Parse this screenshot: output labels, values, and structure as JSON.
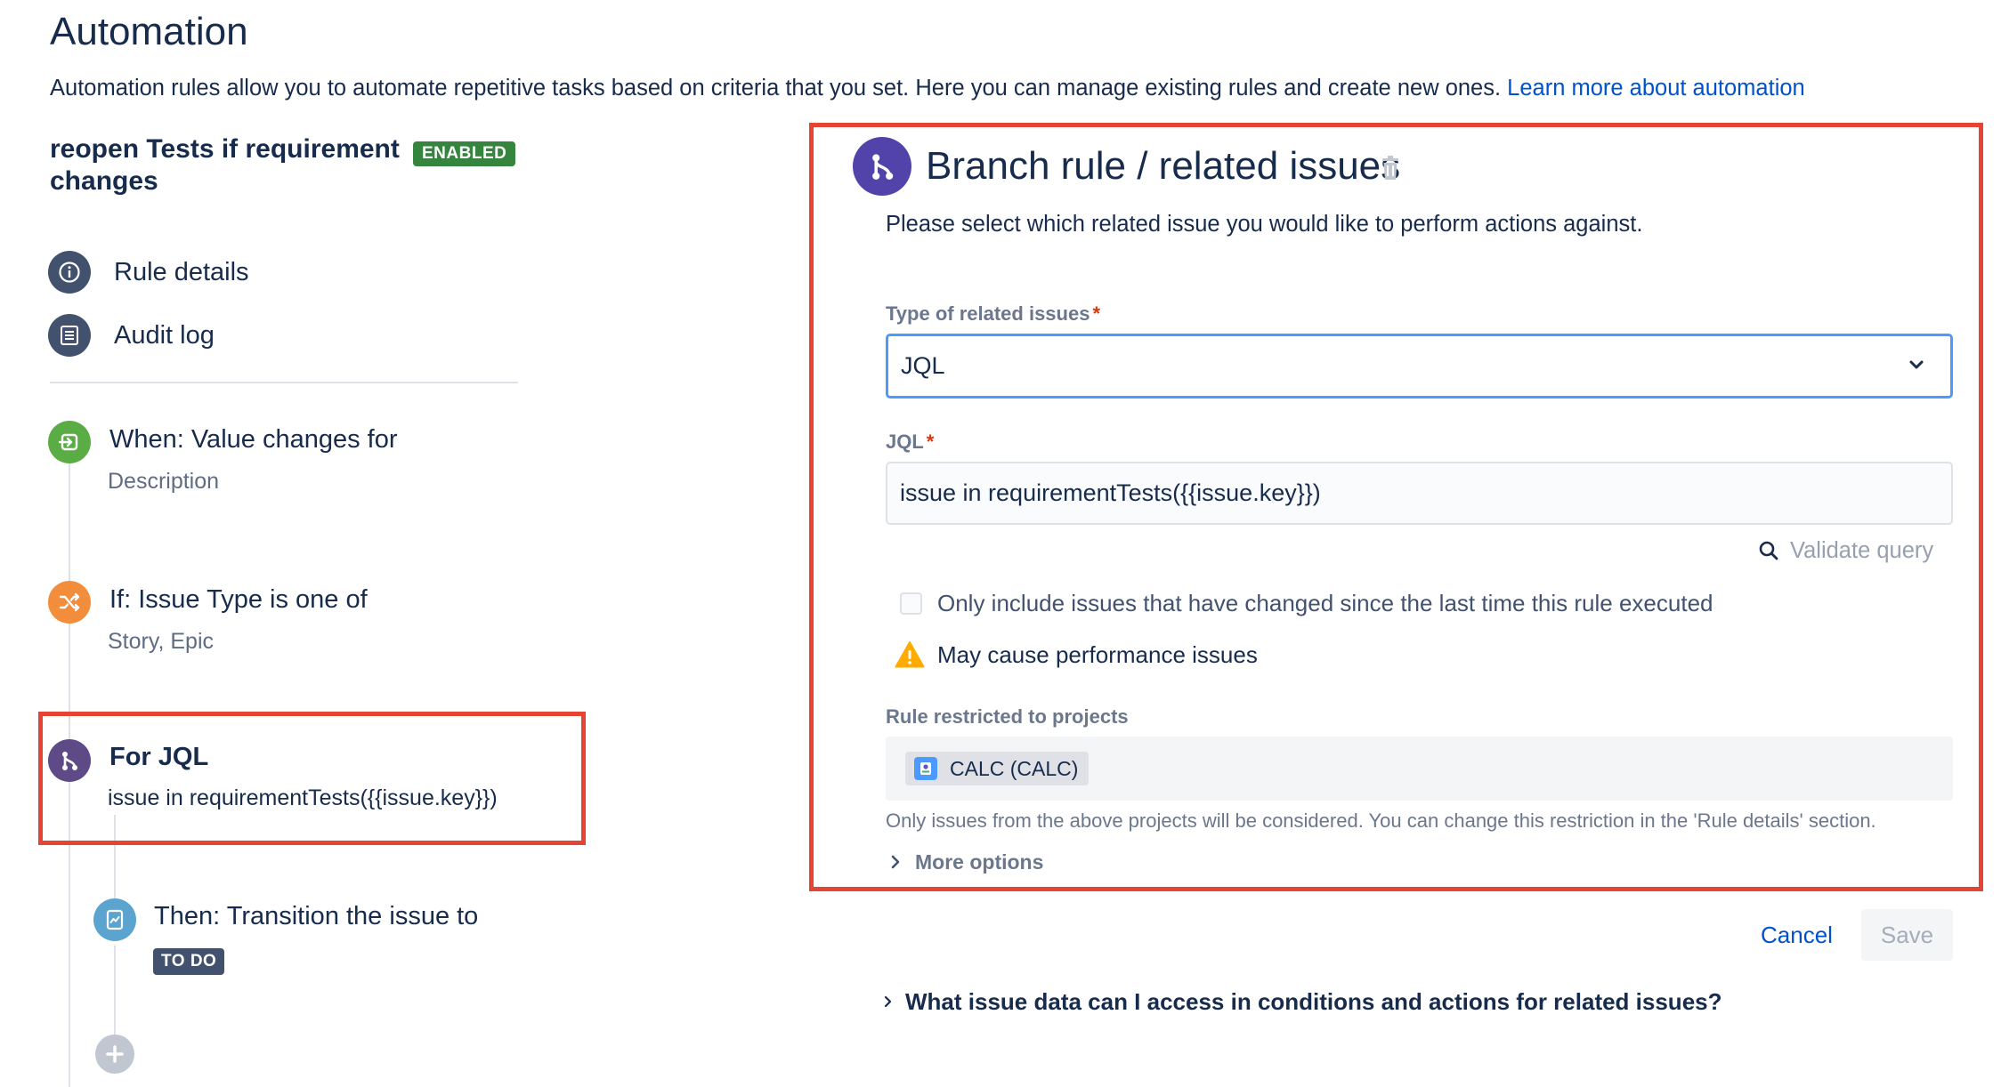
{
  "page": {
    "title": "Automation",
    "description": "Automation rules allow you to automate repetitive tasks based on criteria that you set. Here you can manage existing rules and create new ones.",
    "learn_more_link": "Learn more about automation"
  },
  "rule": {
    "name": "reopen Tests if requirement changes",
    "status_badge": "ENABLED"
  },
  "nav": {
    "rule_details": "Rule details",
    "audit_log": "Audit log"
  },
  "components": {
    "trigger": {
      "title": "When: Value changes for",
      "subtitle": "Description",
      "color": "#5aac44"
    },
    "condition": {
      "title": "If: Issue Type is one of",
      "subtitle": "Story, Epic",
      "color": "#f18d3b"
    },
    "branch": {
      "title": "For JQL",
      "subtitle": "issue in requirementTests({{issue.key}})",
      "color": "#5e4a87"
    },
    "action": {
      "title": "Then: Transition the issue to",
      "lozenge": "TO DO",
      "color": "#5ba4cf"
    }
  },
  "panel": {
    "title": "Branch rule / related issues",
    "description": "Please select which related issue you would like to perform actions against.",
    "type_label": "Type of related issues",
    "type_value": "JQL",
    "jql_label": "JQL",
    "jql_value": "issue in requirementTests({{issue.key}})",
    "validate_label": "Validate query",
    "checkbox_label": "Only include issues that have changed since the last time this rule executed",
    "checkbox_checked": false,
    "warning_text": "May cause performance issues",
    "projects_label": "Rule restricted to projects",
    "project_tag": "CALC (CALC)",
    "projects_note": "Only issues from the above projects will be considered. You can change this restriction in the 'Rule details' section.",
    "more_options": "More options"
  },
  "actions": {
    "cancel": "Cancel",
    "save": "Save"
  },
  "faq": "What issue data can I access in conditions and actions for related issues?",
  "colors": {
    "accent": "#0052cc",
    "highlight_border": "#e54435",
    "enabled_badge": "#36853f",
    "branch_icon": "#5243aa"
  }
}
